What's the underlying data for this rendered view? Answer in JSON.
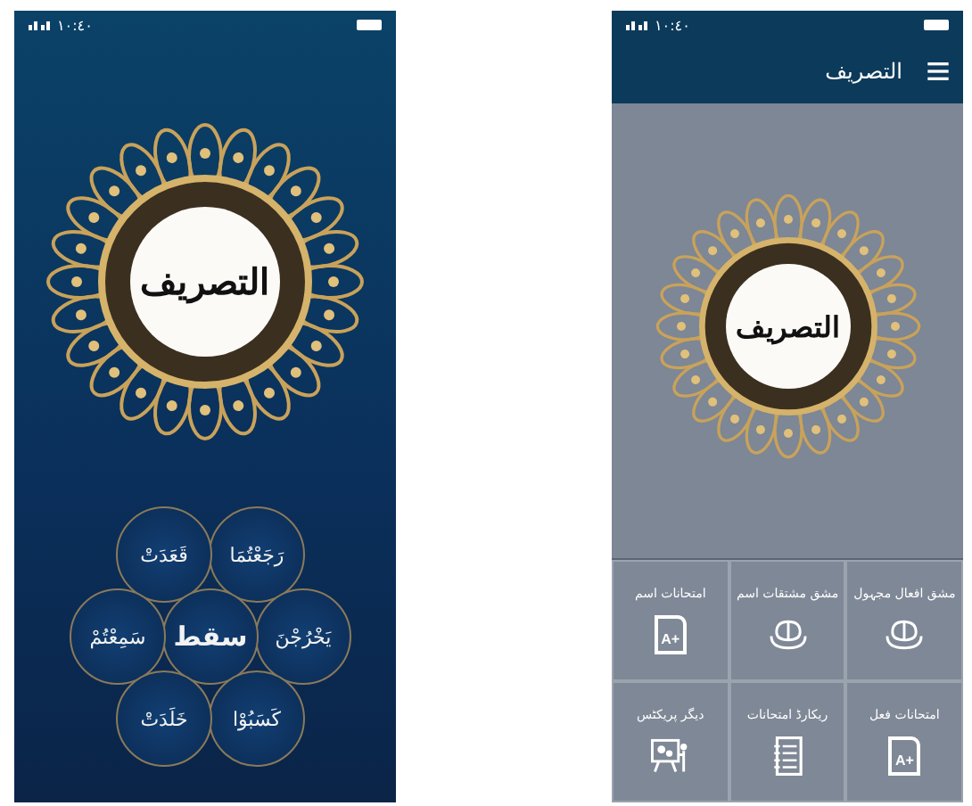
{
  "splash_screen": {
    "status_time": "١٠:٤٠",
    "logo_text": "التصريف",
    "words": [
      "رَجَعْتُمَا",
      "قَعَدَتْ",
      "يَخْرُجْنَ",
      "سقط",
      "سَمِعْتُمْ",
      "كَسَبُوْا",
      "خَلَدَتْ"
    ]
  },
  "home_screen": {
    "status_time": "١٠:٤٠",
    "title": "التصريف",
    "logo_text": "التصريف",
    "tiles": [
      {
        "label": "مشق افعال مجہول",
        "kind": "brain"
      },
      {
        "label": "مشق مشتقات اسم",
        "kind": "brain"
      },
      {
        "label": "امتحانات اسم",
        "kind": "exam",
        "badge": "A+"
      },
      {
        "label": "امتحانات فعل",
        "kind": "exam",
        "badge": "A+"
      },
      {
        "label": "ریکارڈ امتحانات",
        "kind": "record"
      },
      {
        "label": "دیگر پریکٹس",
        "kind": "practice"
      }
    ]
  }
}
